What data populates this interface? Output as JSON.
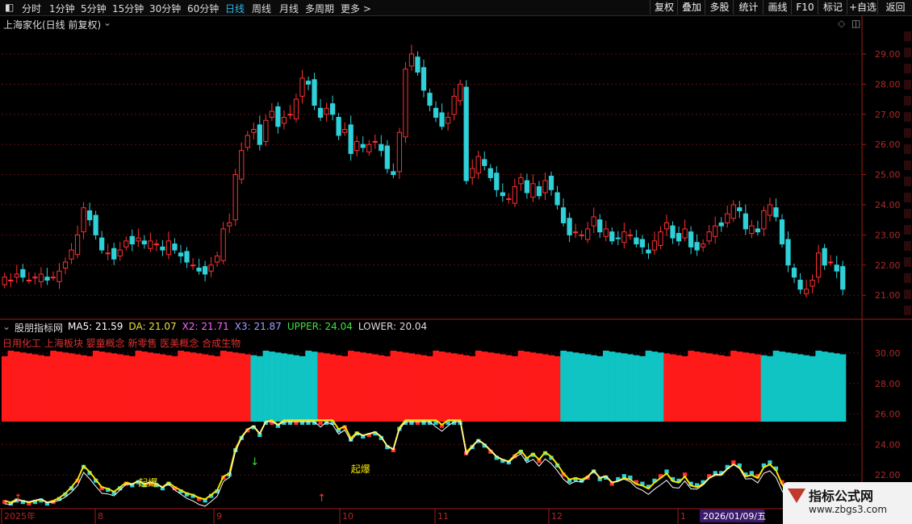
{
  "toolbar": {
    "periods": [
      "分时",
      "1分钟",
      "5分钟",
      "15分钟",
      "30分钟",
      "60分钟",
      "日线",
      "周线",
      "月线",
      "多周期",
      "更多 >"
    ],
    "active_period": "日线",
    "right_buttons": [
      "复权",
      "叠加",
      "多股",
      "统计",
      "画线",
      "F10",
      "标记",
      "+自选",
      "返回"
    ]
  },
  "header": {
    "title": "上海家化(日线 前复权)"
  },
  "indicator": {
    "name": "股朋指标网",
    "values": [
      {
        "label": "MA5: 21.59",
        "color": "#ffffff"
      },
      {
        "label": "DA: 21.07",
        "color": "#f0e040"
      },
      {
        "label": "X2: 21.71",
        "color": "#ff66ff"
      },
      {
        "label": "X3: 21.87",
        "color": "#a0a0ff"
      },
      {
        "label": "UPPER: 24.04",
        "color": "#40e040"
      },
      {
        "label": "LOWER: 20.04",
        "color": "#dddddd"
      }
    ],
    "concepts": "日用化工 上海板块 婴童概念 新零售 医美概念 合成生物",
    "signal_label": "起爆"
  },
  "colors": {
    "up": "#ff3030",
    "down": "#2fd0d8",
    "axis": "#a81818",
    "grid": "#5a1010",
    "yellow": "#f5e600"
  },
  "price_axis": [
    "29.00",
    "28.00",
    "27.00",
    "26.00",
    "25.00",
    "24.00",
    "23.00",
    "22.00",
    "21.00"
  ],
  "indicator_axis": [
    "30.00",
    "28.00",
    "26.00",
    "24.00",
    "22.00"
  ],
  "date_axis": [
    "2025年",
    "8",
    "9",
    "10",
    "11",
    "12",
    "1"
  ],
  "cursor_date": "2026/01/09/五",
  "watermark": {
    "title": "指标公式网",
    "url": "www.zbgs3.com"
  },
  "chart_data": {
    "type": "candlestick",
    "title": "上海家化(日线 前复权)",
    "closes": [
      21.6,
      21.5,
      21.7,
      21.6,
      21.5,
      21.6,
      21.7,
      21.5,
      21.6,
      21.8,
      22.1,
      22.5,
      23.0,
      23.9,
      23.5,
      23.0,
      22.5,
      22.4,
      22.2,
      22.5,
      22.8,
      22.7,
      22.9,
      22.7,
      22.8,
      22.7,
      22.5,
      22.8,
      22.5,
      22.3,
      22.1,
      22.0,
      21.8,
      21.7,
      22.0,
      22.3,
      23.2,
      23.4,
      25.0,
      25.8,
      26.3,
      26.5,
      26.0,
      26.8,
      27.1,
      26.6,
      26.9,
      27.0,
      27.5,
      28.2,
      28.0,
      27.3,
      26.9,
      27.2,
      27.0,
      26.3,
      26.5,
      25.7,
      26.1,
      25.9,
      26.0,
      26.1,
      25.8,
      25.2,
      25.0,
      26.4,
      28.5,
      29.0,
      28.4,
      27.8,
      27.3,
      26.9,
      26.6,
      26.9,
      27.6,
      28.0,
      24.8,
      25.2,
      25.6,
      25.3,
      24.9,
      24.5,
      24.3,
      24.2,
      24.6,
      24.9,
      24.4,
      24.7,
      24.3,
      24.8,
      24.5,
      24.0,
      23.4,
      23.0,
      23.1,
      23.0,
      23.2,
      23.6,
      23.1,
      23.2,
      22.8,
      22.9,
      23.1,
      23.0,
      22.7,
      22.6,
      22.4,
      22.8,
      23.1,
      23.4,
      22.9,
      22.8,
      23.2,
      22.6,
      22.5,
      22.7,
      23.1,
      23.3,
      23.3,
      23.7,
      24.0,
      23.8,
      23.2,
      23.3,
      23.1,
      23.8,
      24.0,
      23.6,
      22.7,
      22.0,
      21.6,
      21.2,
      21.2,
      21.5,
      22.4,
      22.0,
      22.1,
      21.8,
      21.2
    ]
  }
}
